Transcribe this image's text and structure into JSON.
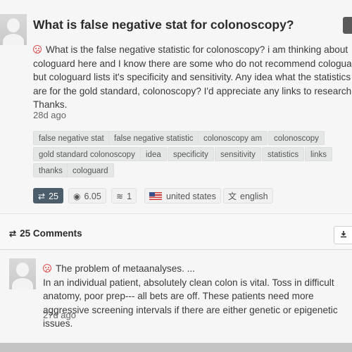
{
  "question": {
    "title": "What is false negative stat for colonoscopy?",
    "body_lines": [
      "What is the false negative statistic for colonoscopy?  i am thinking about",
      "cologuard here and I know there are some who do not recommend cologuard",
      "but cologuard lists it's specificity and sensitivity.  Any idea what the statistics",
      "are for the gold standard, colonoscopy?  I'd appreciate any links to research.",
      "Thanks."
    ],
    "time": "28d ago",
    "tags": [
      "false negative stat",
      "false negative statistic",
      "colonoscopy am",
      "colonoscopy",
      "gold standard colonoscopy",
      "idea",
      "specificity",
      "sensitivity",
      "statistics",
      "links",
      "thanks",
      "cologuard"
    ],
    "stats": {
      "reposts": "25",
      "views": "6.05",
      "signal": "1",
      "country": "united states",
      "language": "english"
    }
  },
  "comments_section": {
    "title": "25 Comments"
  },
  "comment": {
    "title": "The problem of metaanalyses. ...",
    "body_lines": [
      "In an individual patient, absolutely clean colon is vital. Toss in difficult",
      "anatomy, poor prep--- all bets are off. These patients need more",
      "aggressive screening intervals if there are either genetic or epigenetic",
      "issues."
    ],
    "time": "27d ago"
  },
  "icons": {
    "sad": "frown-icon",
    "repost": "retweet-icon",
    "views": "eye-icon",
    "signal": "wifi-icon",
    "flag": "us-flag-icon",
    "translate": "translate-icon",
    "download": "download-icon"
  },
  "colors": {
    "accent_dark": "#4b5d6b",
    "sad": "#d9534f",
    "background": "#c4c4c4",
    "card": "#f6f6f6"
  }
}
